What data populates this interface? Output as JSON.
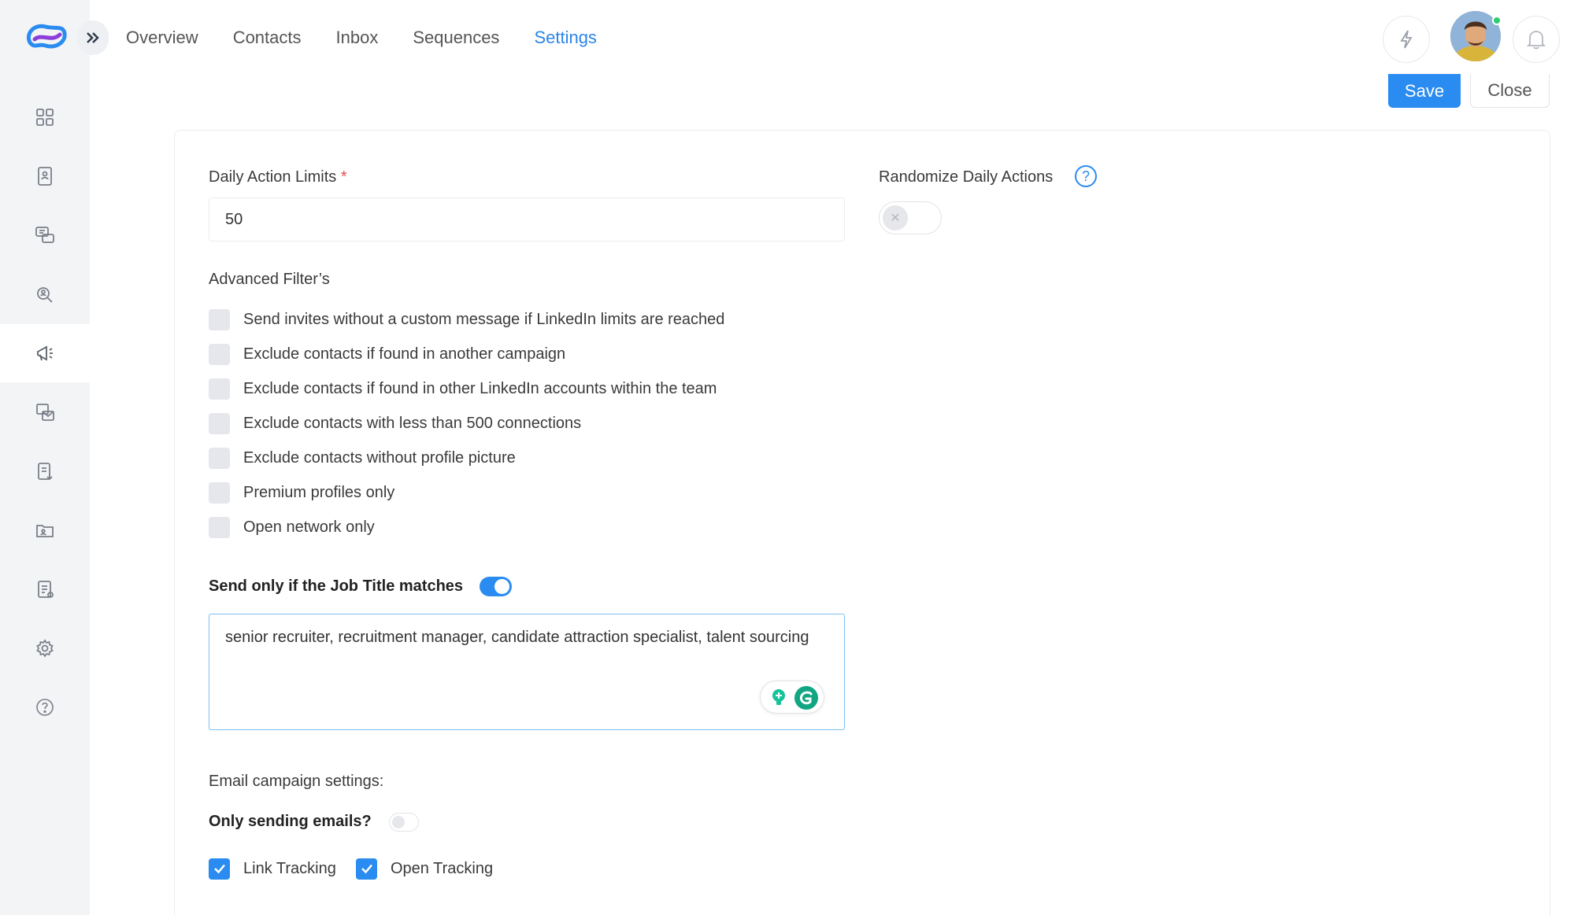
{
  "nav": {
    "items": [
      {
        "label": "Overview",
        "active": false
      },
      {
        "label": "Contacts",
        "active": false
      },
      {
        "label": "Inbox",
        "active": false
      },
      {
        "label": "Sequences",
        "active": false
      },
      {
        "label": "Settings",
        "active": true
      }
    ]
  },
  "sidebar": {
    "items": [
      {
        "icon": "dashboard-icon"
      },
      {
        "icon": "contacts-book-icon"
      },
      {
        "icon": "messages-icon"
      },
      {
        "icon": "search-people-icon"
      },
      {
        "icon": "campaign-megaphone-icon",
        "active": true
      },
      {
        "icon": "email-templates-icon"
      },
      {
        "icon": "export-report-icon"
      },
      {
        "icon": "folder-contacts-icon"
      },
      {
        "icon": "document-list-icon"
      },
      {
        "icon": "gear-icon"
      },
      {
        "icon": "help-icon"
      }
    ]
  },
  "toolbar": {
    "save_label": "Save",
    "close_label": "Close"
  },
  "form": {
    "daily_limits_label": "Daily Action Limits",
    "required_mark": "*",
    "daily_limits_value": "50",
    "randomize_label": "Randomize Daily Actions",
    "randomize_help": "?",
    "randomize_enabled": false,
    "advanced_label": "Advanced Filter’s",
    "filters": [
      {
        "label": "Send invites without a custom message if LinkedIn limits are reached",
        "checked": false
      },
      {
        "label": "Exclude contacts if found in another campaign",
        "checked": false
      },
      {
        "label": "Exclude contacts if found in other LinkedIn accounts within the team",
        "checked": false
      },
      {
        "label": "Exclude contacts with less than 500 connections",
        "checked": false
      },
      {
        "label": "Exclude contacts without profile picture",
        "checked": false
      },
      {
        "label": "Premium profiles only",
        "checked": false
      },
      {
        "label": "Open network only",
        "checked": false
      }
    ],
    "job_title_label": "Send only if the Job Title matches",
    "job_title_enabled": true,
    "job_title_value": "senior recruiter, recruitment manager, candidate attraction specialist, talent sourcing",
    "email_settings_label": "Email campaign settings:",
    "only_emails_label": "Only sending emails?",
    "only_emails_enabled": false,
    "link_tracking_label": "Link Tracking",
    "link_tracking_checked": true,
    "open_tracking_label": "Open Tracking",
    "open_tracking_checked": true
  },
  "colors": {
    "accent": "#2a8cf0",
    "sidebar_bg": "#f3f4f6",
    "grammarly_green": "#15c39a"
  }
}
